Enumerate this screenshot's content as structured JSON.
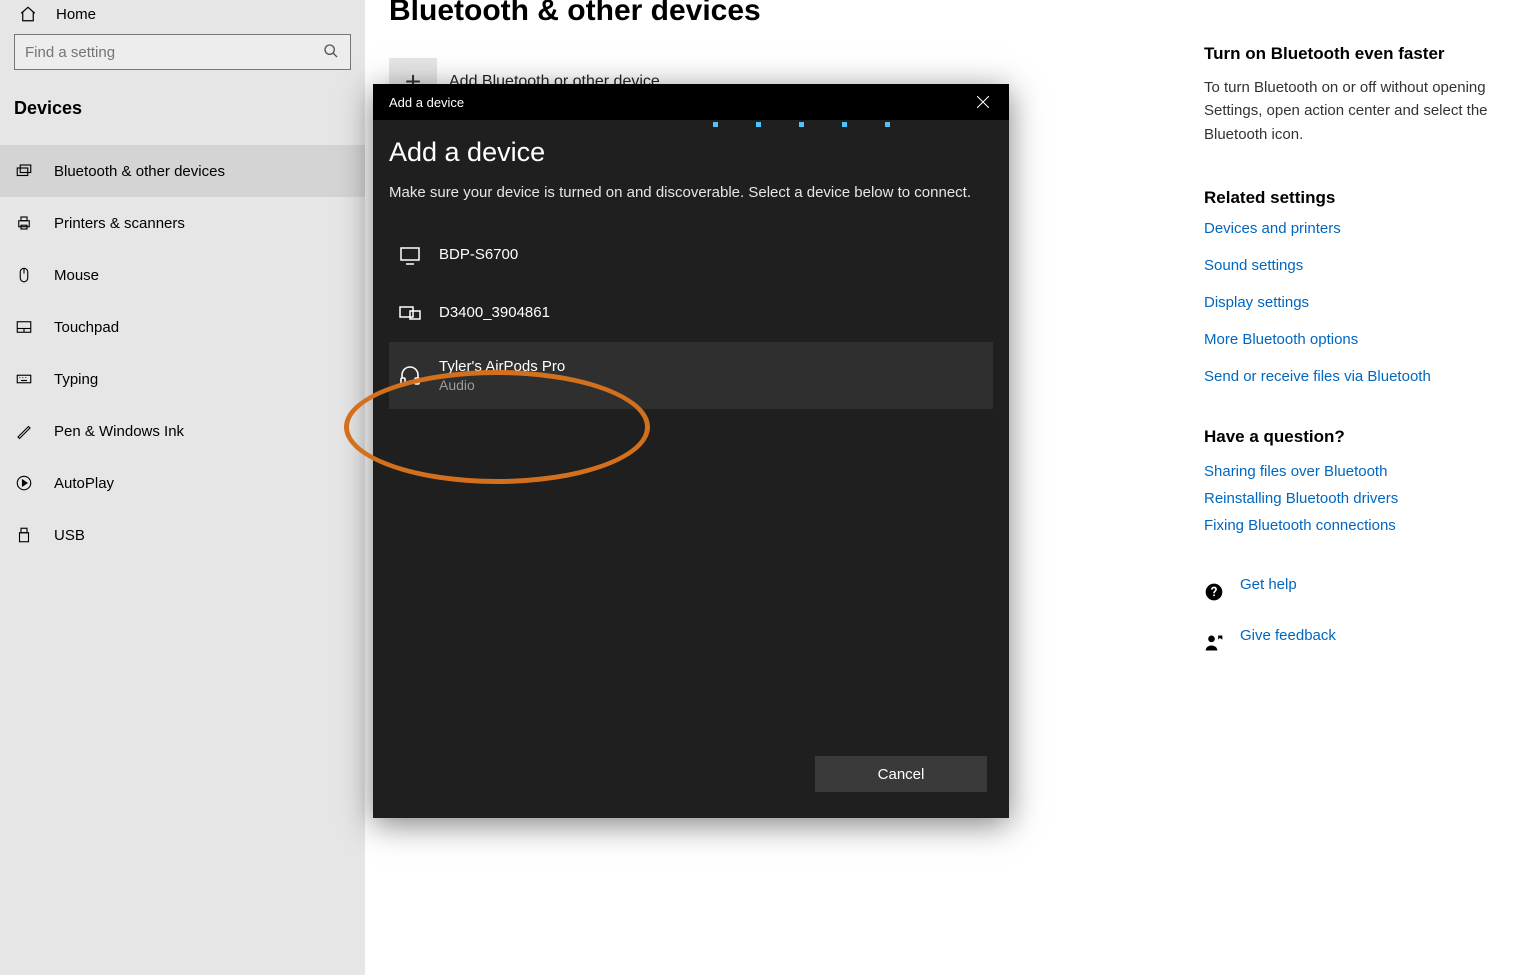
{
  "sidebar": {
    "home": "Home",
    "search_placeholder": "Find a setting",
    "section_title": "Devices",
    "items": [
      {
        "label": "Bluetooth & other devices"
      },
      {
        "label": "Printers & scanners"
      },
      {
        "label": "Mouse"
      },
      {
        "label": "Touchpad"
      },
      {
        "label": "Typing"
      },
      {
        "label": "Pen & Windows Ink"
      },
      {
        "label": "AutoPlay"
      },
      {
        "label": "USB"
      }
    ]
  },
  "main": {
    "page_title": "Bluetooth & other devices",
    "add_label": "Add Bluetooth or other device",
    "add_plus": "+"
  },
  "rail": {
    "tip_heading": "Turn on Bluetooth even faster",
    "tip_body": "To turn Bluetooth on or off without opening Settings, open action center and select the Bluetooth icon.",
    "related_heading": "Related settings",
    "related_links": [
      "Devices and printers",
      "Sound settings",
      "Display settings",
      "More Bluetooth options",
      "Send or receive files via Bluetooth"
    ],
    "question_heading": "Have a question?",
    "question_links": [
      "Sharing files over Bluetooth",
      "Reinstalling Bluetooth drivers",
      "Fixing Bluetooth connections"
    ],
    "get_help": "Get help",
    "give_feedback": "Give feedback"
  },
  "dialog": {
    "titlebar": "Add a device",
    "heading": "Add a device",
    "subheading": "Make sure your device is turned on and discoverable. Select a device below to connect.",
    "devices": [
      {
        "name": "BDP-S6700",
        "sub": ""
      },
      {
        "name": "D3400_3904861",
        "sub": ""
      },
      {
        "name": "Tyler's AirPods Pro",
        "sub": "Audio"
      }
    ],
    "cancel": "Cancel"
  }
}
